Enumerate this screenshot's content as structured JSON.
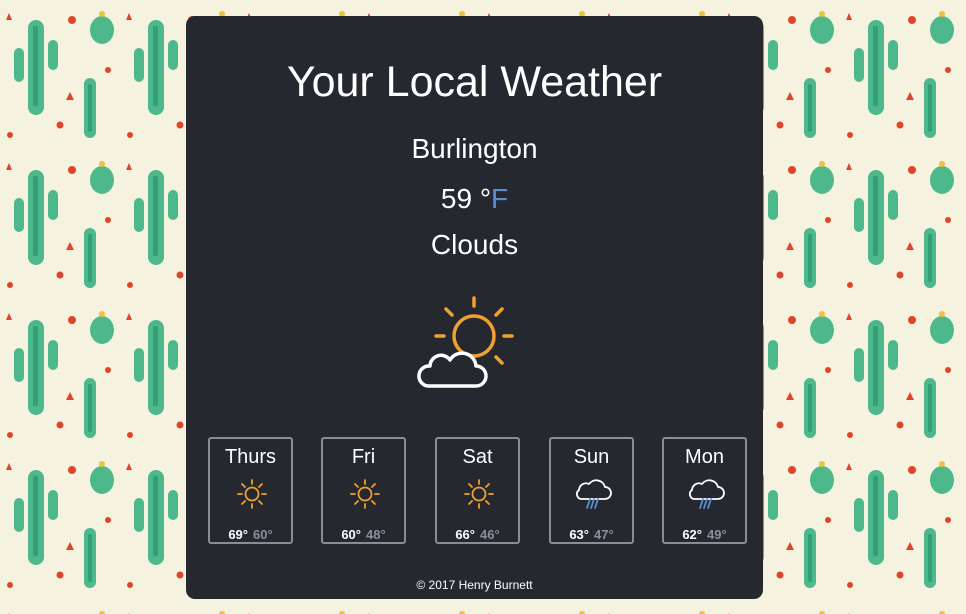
{
  "header": {
    "title": "Your Local Weather"
  },
  "current": {
    "city": "Burlington",
    "temperature": "59",
    "unit_symbol": "°",
    "unit_letter": "F",
    "condition": "Clouds",
    "icon": "partly-cloudy-icon"
  },
  "forecast": [
    {
      "day": "Thurs",
      "icon": "sun-icon",
      "high": "69°",
      "low": "60°"
    },
    {
      "day": "Fri",
      "icon": "sun-icon",
      "high": "60°",
      "low": "48°"
    },
    {
      "day": "Sat",
      "icon": "sun-icon",
      "high": "66°",
      "low": "46°"
    },
    {
      "day": "Sun",
      "icon": "rain-cloud-icon",
      "high": "63°",
      "low": "47°"
    },
    {
      "day": "Mon",
      "icon": "rain-cloud-icon",
      "high": "62°",
      "low": "49°"
    }
  ],
  "footer": {
    "text": "© 2017 Henry Burnett"
  },
  "colors": {
    "card_background": "#262830",
    "sun": "#f0a030",
    "unit_accent": "#5b8fd1",
    "rain": "#5b8fd1",
    "background": "#f6f2e0",
    "cactus": "#2fae7e",
    "flower": "#e0452a"
  }
}
